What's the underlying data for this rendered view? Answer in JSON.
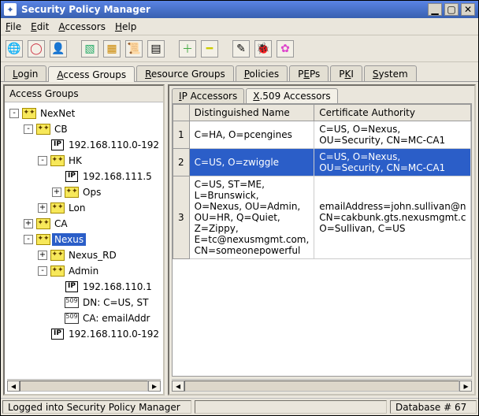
{
  "window": {
    "title": "Security Policy Manager"
  },
  "menu": {
    "file": "File",
    "edit": "Edit",
    "accessors": "Accessors",
    "help": "Help"
  },
  "toolbar_icons": [
    "globe",
    "ring",
    "person",
    "box-blue",
    "box-yellow",
    "scroll",
    "doc",
    "plus",
    "minus",
    "brush",
    "bug",
    "flower"
  ],
  "main_tabs": {
    "login": "Login",
    "access_groups": "Access Groups",
    "resource_groups": "Resource Groups",
    "policies": "Policies",
    "peps": "PEPs",
    "pki": "PKI",
    "system": "System",
    "active": "access_groups"
  },
  "left": {
    "title": "Access Groups",
    "tree": [
      {
        "depth": 0,
        "exp": "-",
        "icon": "group",
        "label": "NexNet",
        "sel": false
      },
      {
        "depth": 1,
        "exp": "-",
        "icon": "group",
        "label": "CB",
        "sel": false
      },
      {
        "depth": 2,
        "exp": "",
        "icon": "ip",
        "label": "192.168.110.0-192",
        "sel": false
      },
      {
        "depth": 2,
        "exp": "-",
        "icon": "group",
        "label": "HK",
        "sel": false
      },
      {
        "depth": 3,
        "exp": "",
        "icon": "ip",
        "label": "192.168.111.5",
        "sel": false
      },
      {
        "depth": 3,
        "exp": "+",
        "icon": "group",
        "label": "Ops",
        "sel": false
      },
      {
        "depth": 2,
        "exp": "+",
        "icon": "group",
        "label": "Lon",
        "sel": false
      },
      {
        "depth": 1,
        "exp": "+",
        "icon": "group",
        "label": "CA",
        "sel": false
      },
      {
        "depth": 1,
        "exp": "-",
        "icon": "group",
        "label": "Nexus",
        "sel": true
      },
      {
        "depth": 2,
        "exp": "+",
        "icon": "group",
        "label": "Nexus_RD",
        "sel": false
      },
      {
        "depth": 2,
        "exp": "-",
        "icon": "group",
        "label": "Admin",
        "sel": false
      },
      {
        "depth": 3,
        "exp": "",
        "icon": "ip",
        "label": "192.168.110.1",
        "sel": false
      },
      {
        "depth": 3,
        "exp": "",
        "icon": "x509",
        "label": "DN: C=US, ST",
        "sel": false
      },
      {
        "depth": 3,
        "exp": "",
        "icon": "x509b",
        "label": "CA: emailAddr",
        "sel": false
      },
      {
        "depth": 2,
        "exp": "",
        "icon": "ip",
        "label": "192.168.110.0-192",
        "sel": false
      }
    ]
  },
  "right": {
    "sub_tabs": {
      "ip": "IP Accessors",
      "x509": "X.509 Accessors",
      "active": "x509"
    },
    "columns": {
      "rownum": "",
      "dn": "Distinguished Name",
      "ca": "Certificate Authority"
    },
    "rows": [
      {
        "n": "1",
        "dn": "C=HA, O=pcengines",
        "ca": "C=US, O=Nexus, OU=Security, CN=MC-CA1",
        "sel": false
      },
      {
        "n": "2",
        "dn": "C=US, O=zwiggle",
        "ca": "C=US, O=Nexus, OU=Security, CN=MC-CA1",
        "sel": true
      },
      {
        "n": "3",
        "dn": "C=US, ST=ME, L=Brunswick, O=Nexus, OU=Admin, OU=HR, Q=Quiet, Z=Zippy, E=tc@nexusmgmt.com, CN=someonepowerful",
        "ca": "emailAddress=john.sullivan@n CN=cakbunk.gts.nexusmgmt.c O=Sullivan, C=US",
        "sel": false
      }
    ]
  },
  "status": {
    "left": "Logged into Security Policy Manager",
    "mid": "",
    "right": "Database # 67"
  }
}
